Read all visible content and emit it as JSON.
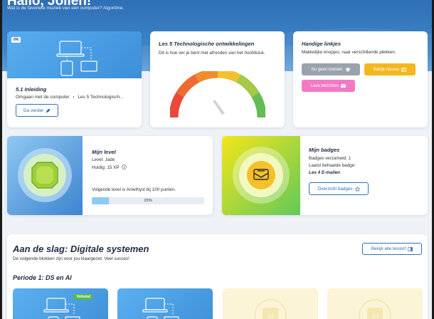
{
  "header": {
    "greeting": "Hallo, Jolien!",
    "subtitle": "Wat is de favoriete muziek van een computer? Algoritme."
  },
  "lesson_card": {
    "progress_badge": "0%",
    "title": "5.1 Inleiding",
    "breadcrumb_a": "Omgaan met de computer",
    "breadcrumb_b": "Les 5 Technologisch...",
    "button": "Ga verder"
  },
  "progress_card": {
    "title": "Les 5 Technologische ontwikkelingen",
    "description": "Dit is hoe ver je bent met afronden van het hoofdstuk.",
    "gauge_level": 0.15
  },
  "links_card": {
    "title": "Handige linkjes",
    "description": "Makkelijke knopjes, naar verschillende plekken.",
    "buttons": [
      {
        "label": "Nu geen toetsen",
        "color": "#9aa3ad"
      },
      {
        "label": "Bekijk nieuws",
        "color": "#f4b71e"
      },
      {
        "label": "Lees berichten",
        "color": "#f27ac2"
      }
    ]
  },
  "level_card": {
    "title": "Mijn level",
    "level": "Level: Jade",
    "xp": "Huidig: 15 XP",
    "next_level": "Volgende level is Amethyst bij 100 punten.",
    "progress_label": "15%",
    "progress": 0.15
  },
  "badges_card": {
    "title": "Mijn badges",
    "collected": "Badges verzameld: 1",
    "last_label": "Laatst behaalde badge:",
    "last_badge": "Les 4 E-mailen",
    "button": "Overzicht badges"
  },
  "section": {
    "title": "Aan de slag: Digitale systemen",
    "subtitle": "De volgende blokken zijn voor jou klaargezet. Veel succes!",
    "button": "Bekijk alle lesstof",
    "period": "Periode 1: DS en AI",
    "tiles": [
      {
        "style": "blue",
        "badge": "Voltooid"
      },
      {
        "style": "blue",
        "badge": ""
      },
      {
        "style": "yellow",
        "badge": ""
      },
      {
        "style": "yellow",
        "badge": ""
      }
    ]
  },
  "colors": {
    "primary": "#2e6fb6",
    "gauge_red": "#e8493a",
    "gauge_orange": "#f08c2c",
    "gauge_yellow": "#f2c12e",
    "gauge_green": "#66bb55"
  }
}
